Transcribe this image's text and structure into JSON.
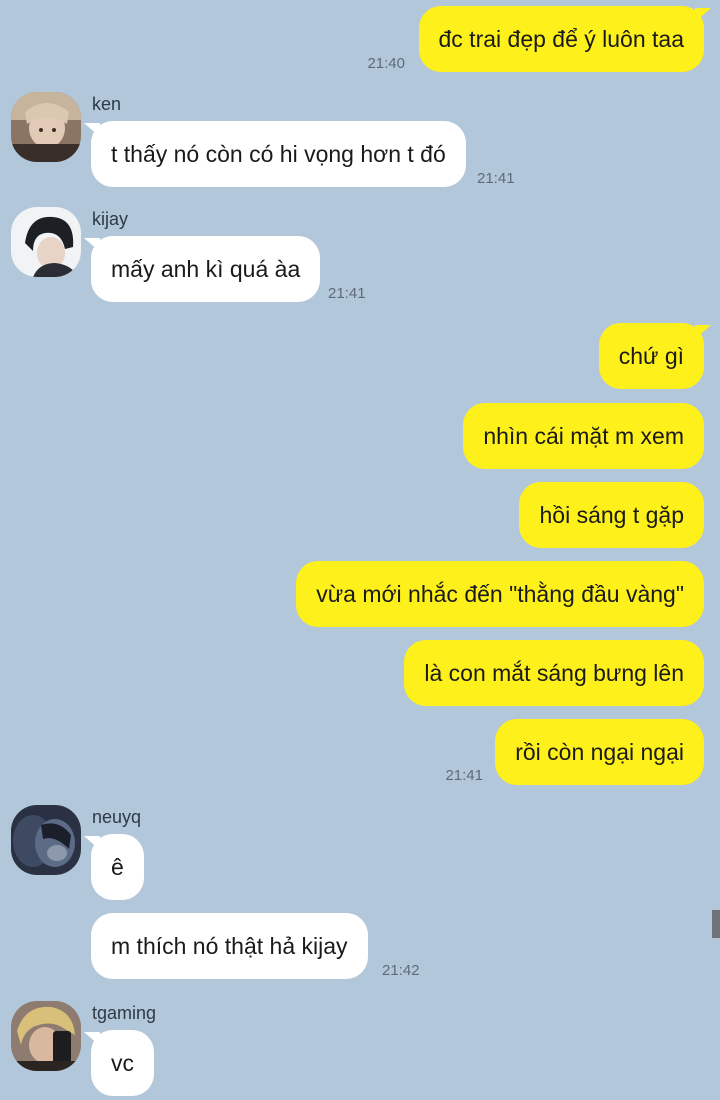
{
  "messages": [
    {
      "text": "đc trai đẹp để ý luôn taa",
      "time": "21:40"
    },
    {
      "sender": "ken",
      "text": "t thấy nó còn có hi vọng hơn t đó",
      "time": "21:41"
    },
    {
      "sender": "kijay",
      "text": "mấy anh kì quá àa",
      "time": "21:41"
    },
    {
      "text": "chứ gì"
    },
    {
      "text": "nhìn cái mặt m xem"
    },
    {
      "text": "hồi sáng t gặp"
    },
    {
      "text": "vừa mới nhắc đến \"thằng đầu vàng\""
    },
    {
      "text": "là con mắt sáng bưng lên"
    },
    {
      "text": "rồi còn ngại ngại",
      "time": "21:41"
    },
    {
      "sender": "neuyq",
      "text": "ê"
    },
    {
      "text": "m thích nó thật hả kijay",
      "time": "21:42"
    },
    {
      "sender": "tgaming",
      "text": "vc"
    }
  ],
  "colors": {
    "background": "#b2c7da",
    "outgoing_bubble": "#fef01b",
    "incoming_bubble": "#ffffff"
  },
  "icons": [
    "avatar-ken",
    "avatar-kijay",
    "avatar-neuyq",
    "avatar-tgaming"
  ]
}
